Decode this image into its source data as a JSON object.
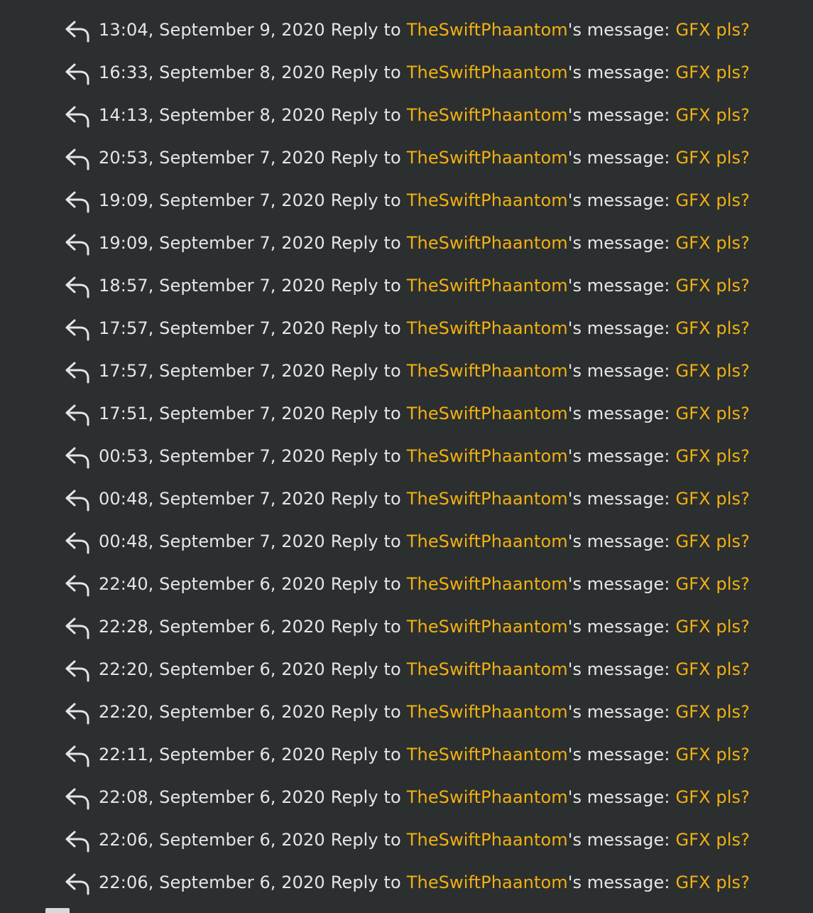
{
  "colors": {
    "background": "#2b2f30",
    "text": "#e6e6e6",
    "accent_link": "#f2b012"
  },
  "reply_icon": "reply-arrow-icon",
  "entries": [
    {
      "timestamp": "13:04, September 9, 2020",
      "action": "Reply to",
      "user": "TheSwiftPhaantom",
      "possessive": "'s message:",
      "message": "GFX pls?"
    },
    {
      "timestamp": "16:33, September 8, 2020",
      "action": "Reply to",
      "user": "TheSwiftPhaantom",
      "possessive": "'s message:",
      "message": "GFX pls?"
    },
    {
      "timestamp": "14:13, September 8, 2020",
      "action": "Reply to",
      "user": "TheSwiftPhaantom",
      "possessive": "'s message:",
      "message": "GFX pls?"
    },
    {
      "timestamp": "20:53, September 7, 2020",
      "action": "Reply to",
      "user": "TheSwiftPhaantom",
      "possessive": "'s message:",
      "message": "GFX pls?"
    },
    {
      "timestamp": "19:09, September 7, 2020",
      "action": "Reply to",
      "user": "TheSwiftPhaantom",
      "possessive": "'s message:",
      "message": "GFX pls?"
    },
    {
      "timestamp": "19:09, September 7, 2020",
      "action": "Reply to",
      "user": "TheSwiftPhaantom",
      "possessive": "'s message:",
      "message": "GFX pls?"
    },
    {
      "timestamp": "18:57, September 7, 2020",
      "action": "Reply to",
      "user": "TheSwiftPhaantom",
      "possessive": "'s message:",
      "message": "GFX pls?"
    },
    {
      "timestamp": "17:57, September 7, 2020",
      "action": "Reply to",
      "user": "TheSwiftPhaantom",
      "possessive": "'s message:",
      "message": "GFX pls?"
    },
    {
      "timestamp": "17:57, September 7, 2020",
      "action": "Reply to",
      "user": "TheSwiftPhaantom",
      "possessive": "'s message:",
      "message": "GFX pls?"
    },
    {
      "timestamp": "17:51, September 7, 2020",
      "action": "Reply to",
      "user": "TheSwiftPhaantom",
      "possessive": "'s message:",
      "message": "GFX pls?"
    },
    {
      "timestamp": "00:53, September 7, 2020",
      "action": "Reply to",
      "user": "TheSwiftPhaantom",
      "possessive": "'s message:",
      "message": "GFX pls?"
    },
    {
      "timestamp": "00:48, September 7, 2020",
      "action": "Reply to",
      "user": "TheSwiftPhaantom",
      "possessive": "'s message:",
      "message": "GFX pls?"
    },
    {
      "timestamp": "00:48, September 7, 2020",
      "action": "Reply to",
      "user": "TheSwiftPhaantom",
      "possessive": "'s message:",
      "message": "GFX pls?"
    },
    {
      "timestamp": "22:40, September 6, 2020",
      "action": "Reply to",
      "user": "TheSwiftPhaantom",
      "possessive": "'s message:",
      "message": "GFX pls?"
    },
    {
      "timestamp": "22:28, September 6, 2020",
      "action": "Reply to",
      "user": "TheSwiftPhaantom",
      "possessive": "'s message:",
      "message": "GFX pls?"
    },
    {
      "timestamp": "22:20, September 6, 2020",
      "action": "Reply to",
      "user": "TheSwiftPhaantom",
      "possessive": "'s message:",
      "message": "GFX pls?"
    },
    {
      "timestamp": "22:20, September 6, 2020",
      "action": "Reply to",
      "user": "TheSwiftPhaantom",
      "possessive": "'s message:",
      "message": "GFX pls?"
    },
    {
      "timestamp": "22:11, September 6, 2020",
      "action": "Reply to",
      "user": "TheSwiftPhaantom",
      "possessive": "'s message:",
      "message": "GFX pls?"
    },
    {
      "timestamp": "22:08, September 6, 2020",
      "action": "Reply to",
      "user": "TheSwiftPhaantom",
      "possessive": "'s message:",
      "message": "GFX pls?"
    },
    {
      "timestamp": "22:06, September 6, 2020",
      "action": "Reply to",
      "user": "TheSwiftPhaantom",
      "possessive": "'s message:",
      "message": "GFX pls?"
    },
    {
      "timestamp": "22:06, September 6, 2020",
      "action": "Reply to",
      "user": "TheSwiftPhaantom",
      "possessive": "'s message:",
      "message": "GFX pls?"
    }
  ]
}
